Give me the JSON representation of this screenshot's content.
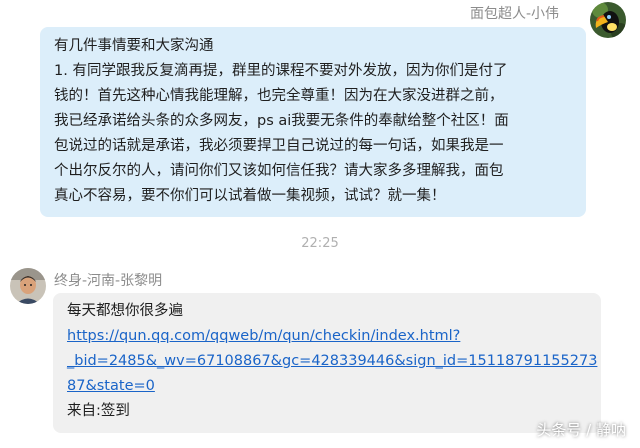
{
  "chat": {
    "self_message": {
      "sender": "面包超人-小伟",
      "lines": [
        "有几件事情要和大家沟通",
        "1. 有同学跟我反复滴再提，群里的课程不要对外发放，因为你们是付了",
        "钱的！首先这种心情我能理解，也完全尊重！因为在大家没进群之前，",
        "我已经承诺给头条的众多网友，ps ai我要无条件的奉献给整个社区！面",
        "包说过的话就是承诺，我必须要捍卫自己说过的每一句话，如果我是一",
        "个出尔反尔的人，请问你们又该如何信任我？请大家多多理解我，面包",
        "真心不容易，要不你们可以试着做一集视频，试试？就一集！"
      ]
    },
    "timestamp": "22:25",
    "other_message": {
      "sender": "终身-河南-张黎明",
      "text": "每天都想你很多遍",
      "link_lines": [
        "https://qun.qq.com/qqweb/m/qun/checkin/index.html?",
        "_bid=2485&_wv=67108867&gc=428339446&sign_id=15118791155273",
        "87&state=0"
      ],
      "source": "来自:签到"
    }
  },
  "watermark": "头条号 / 静呐",
  "colors": {
    "self_bubble": "#dceefa",
    "other_bubble": "#f0f0f0",
    "link": "#1a64c8"
  }
}
